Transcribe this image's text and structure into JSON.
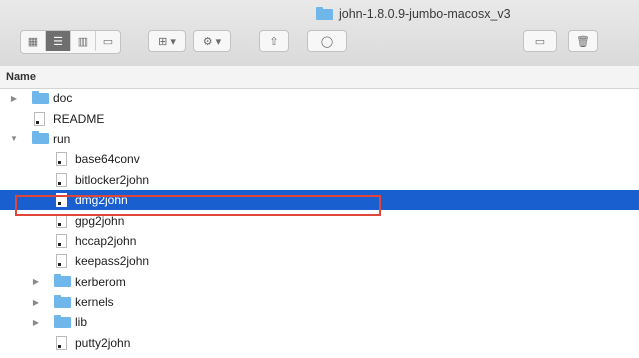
{
  "window": {
    "title": "john-1.8.0.9-jumbo-macosx_v3"
  },
  "toolbar": {
    "view_icons": "▦",
    "view_list": "☰",
    "view_columns": "▥",
    "view_gallery": "▭",
    "group_label": "⊞ ▾",
    "action_label": "⚙ ▾",
    "share_label": "⇧",
    "tag_label": "◯",
    "newfolder_label": "▭",
    "trash_label": "🗑"
  },
  "header": {
    "name": "Name"
  },
  "rows": [
    {
      "name": "doc",
      "kind": "folder",
      "depth": 0,
      "expanded": false
    },
    {
      "name": "README",
      "kind": "file",
      "depth": 0
    },
    {
      "name": "run",
      "kind": "folder",
      "depth": 0,
      "expanded": true
    },
    {
      "name": "base64conv",
      "kind": "file",
      "depth": 1
    },
    {
      "name": "bitlocker2john",
      "kind": "file",
      "depth": 1
    },
    {
      "name": "dmg2john",
      "kind": "file",
      "depth": 1,
      "selected": true
    },
    {
      "name": "gpg2john",
      "kind": "file",
      "depth": 1
    },
    {
      "name": "hccap2john",
      "kind": "file",
      "depth": 1
    },
    {
      "name": "keepass2john",
      "kind": "file",
      "depth": 1
    },
    {
      "name": "kerberom",
      "kind": "folder",
      "depth": 1,
      "expanded": false
    },
    {
      "name": "kernels",
      "kind": "folder",
      "depth": 1,
      "expanded": false
    },
    {
      "name": "lib",
      "kind": "folder",
      "depth": 1,
      "expanded": false
    },
    {
      "name": "putty2john",
      "kind": "file",
      "depth": 1
    }
  ],
  "colors": {
    "selection": "#1a5fd0",
    "folder": "#6fb6ea",
    "annotation": "#e0453a"
  }
}
